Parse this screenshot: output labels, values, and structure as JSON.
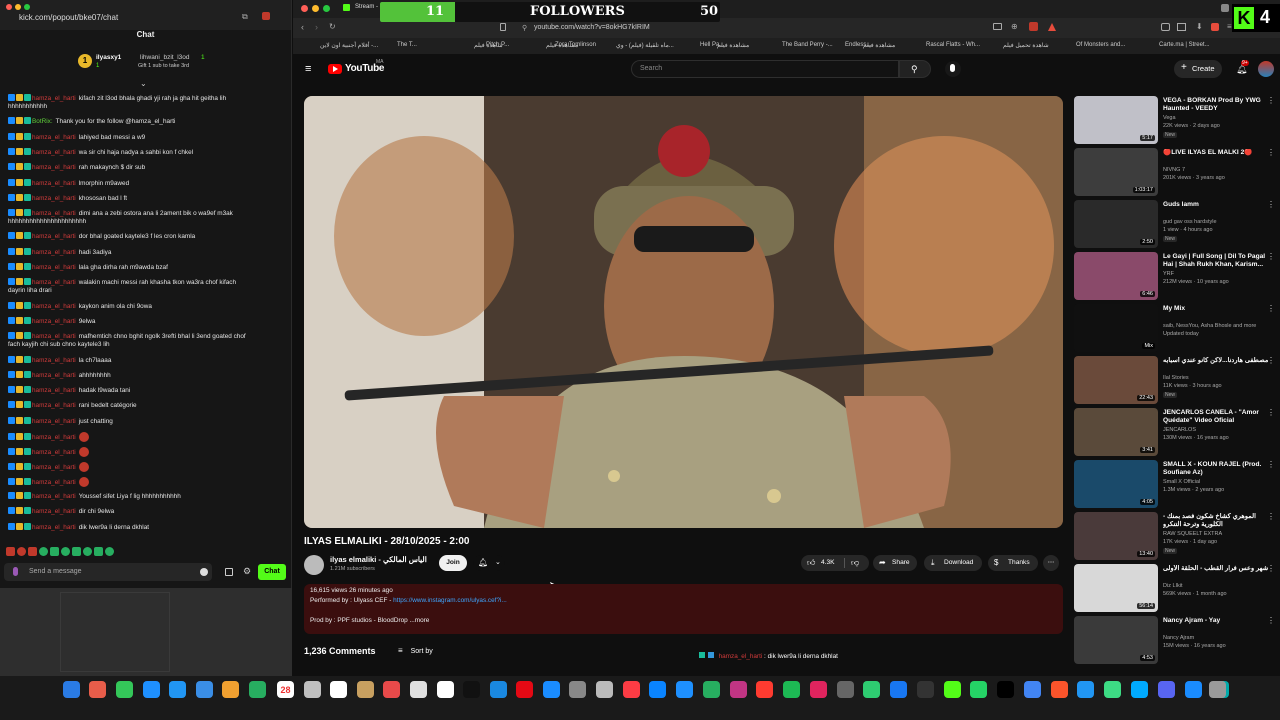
{
  "overlay": {
    "count_left": "11",
    "label": "FOLLOWERS",
    "count_right": "50",
    "progress_fraction": 0.22,
    "corner_badge": "4"
  },
  "chat": {
    "url": "kick.com/popout/bke07/chat",
    "title": "Chat",
    "pinned_user": "ilyasxy1",
    "pinned_target": "lihwani_bzit_l3od",
    "pinned_count": "1",
    "pinned_line": "Gift 1 sub to take 3rd",
    "pinned_line2": "1",
    "messages": [
      {
        "user": "hamza_el_harti",
        "text": "kifach zit l3od bhala ghadi yji rah ja gha hit geitha lih",
        "cont": "hhhhhhhhhhh"
      },
      {
        "user": "BotRix:",
        "text": "Thank you for the follow @hamza_el_harti",
        "bot": true
      },
      {
        "user": "hamza_el_harti",
        "text": "lahiyed bad messi a w9"
      },
      {
        "user": "hamza_el_harti",
        "text": "wa sir chi haja nadya a sahbi kon f chkel"
      },
      {
        "user": "hamza_el_harti",
        "text": "rah makaynch $ dir sub"
      },
      {
        "user": "hamza_el_harti",
        "text": "lmorphin m9awed"
      },
      {
        "user": "hamza_el_harti",
        "text": "khososan bad l ft"
      },
      {
        "user": "hamza_el_harti",
        "text": "dimi ana a zebi ostora ana li 2ament bik o wa9ef m3ak",
        "cont": "hhhhhhhhhhhhhhhhhhhhhh"
      },
      {
        "user": "hamza_el_harti",
        "text": "dor bhal goated kaytele3 f les cron kamla"
      },
      {
        "user": "hamza_el_harti",
        "text": "hadi 3adiya"
      },
      {
        "user": "hamza_el_harti",
        "text": "lala gha dirha rah m9awda bzaf"
      },
      {
        "user": "hamza_el_harti",
        "text": "walakin machi messi rah khasha tkon wa3ra chof kifach",
        "cont": "dayrin liha drari"
      },
      {
        "user": "hamza_el_harti",
        "text": "kaykon anim ola chi 9owa"
      },
      {
        "user": "hamza_el_harti",
        "text": "9elwa"
      },
      {
        "user": "hamza_el_harti",
        "text": "mafhemtich chno bghit ngolk 3refti bhal li 3end goated chof",
        "cont": "fach kayjih chi sub chno kaytele3 lih"
      },
      {
        "user": "hamza_el_harti",
        "text": "la ch7laaaa"
      },
      {
        "user": "hamza_el_harti",
        "text": "ahhhhhhhh"
      },
      {
        "user": "hamza_el_harti",
        "text": "hadak l9wada tani"
      },
      {
        "user": "hamza_el_harti",
        "text": "rani bedelt catégorie"
      },
      {
        "user": "hamza_el_harti",
        "text": "just chatting"
      },
      {
        "user": "hamza_el_harti",
        "text": "",
        "emote": true
      },
      {
        "user": "hamza_el_harti",
        "text": "",
        "emote": true
      },
      {
        "user": "hamza_el_harti",
        "text": "",
        "emote": true
      },
      {
        "user": "hamza_el_harti",
        "text": "",
        "emote": true
      },
      {
        "user": "hamza_el_harti",
        "text": "Youssef sifet Liya f lig hhhhhhhhhhh"
      },
      {
        "user": "hamza_el_harti",
        "text": "dir chi 9elwa"
      },
      {
        "user": "hamza_el_harti",
        "text": "dik lwer9a li derna dkhlat"
      }
    ],
    "send_placeholder": "Send a message",
    "send_button": "Chat"
  },
  "browser": {
    "tab_title": "Stream - Kick Dash",
    "url": "youtube.com/watch?v=8okHG7kIRIM",
    "bookmarks": [
      "أفلام أجنبية اون لاين -...",
      "The T...",
      "شاهدة فيلم",
      "Pitch P...",
      "مشاهدة فيلم",
      "Zora Tomlinson",
      "ماه تلقيلة (فيلم) - وي...",
      "Hell Pa...",
      "مشاهدة فيلم",
      "The Band Perry -...",
      "Endless...",
      "مشاهدة فيلم",
      "Rascal Flatts - Wh...",
      "شاهدة تحميل فيلم",
      "Of Monsters and...",
      "Carte.ma | Street..."
    ]
  },
  "youtube": {
    "logo": "YouTube",
    "logo_region": "MA",
    "search_placeholder": "Search",
    "create_label": "Create",
    "notif_count": "9+",
    "video_title": "ILYAS ELMALIKI - 28/10/2025 - 2:00",
    "channel_name": "ilyas elmaliki - الياس المالكي",
    "channel_subs": "1.21M subscribers",
    "join_label": "Join",
    "likes": "4.3K",
    "share_label": "Share",
    "download_label": "Download",
    "thanks_label": "Thanks",
    "views_line": "16,615 views  26 minutes ago",
    "performed_by": "Performed by : Ulyass CEF - ",
    "performed_link": "https://www.instagram.com/ulyas.cef?i...",
    "prod_by": "Prod by : PPF studios - BloodDrop",
    "more_label": "...more",
    "comments_count": "1,236 Comments",
    "sort_label": "Sort by",
    "overlay_user": "hamza_el_harti",
    "overlay_text": ": dik lwer9a li derna dkhlat"
  },
  "recommendations": [
    {
      "title": "VEGA - BORKAN Prod By YWG Haunted - VEEDY",
      "channel": "Vega",
      "meta": "22K views · 2 days ago",
      "badge": "New",
      "duration": "5:17",
      "color": "#c0c0c8"
    },
    {
      "title": "🔴LIVE ILYAS EL MALKI 2🔴",
      "channel": "NIVNG 7",
      "meta": "201K views · 3 years ago",
      "badge": "",
      "duration": "1:03:17",
      "color": "#3d3d3d"
    },
    {
      "title": "Guds lamm",
      "channel": "gud gav oss hardstyle",
      "meta": "1 view · 4 hours ago",
      "badge": "New",
      "duration": "2:50",
      "color": "#2a2a2a"
    },
    {
      "title": "Le Gayi | Full Song | Dil To Pagal Hai | Shah Rukh Khan, Karism...",
      "channel": "YRF",
      "meta": "212M views · 10 years ago",
      "badge": "",
      "duration": "6:46",
      "color": "#8a4a6a"
    },
    {
      "title": "My Mix",
      "channel": "saib, NessYou, Asha Bhosle and more",
      "meta": "Updated today",
      "badge": "",
      "duration": "Mix",
      "color": "#101010"
    },
    {
      "title": "مصطفى هاردنا...لاكن كانو عندي أسبابه",
      "channel": "Ilal Stories",
      "meta": "11K views · 3 hours ago",
      "badge": "New",
      "duration": "22:43",
      "color": "#6a4a3a"
    },
    {
      "title": "JENCARLOS CANELA - \"Amor Quédate\" Video Oficial",
      "channel": "JENCARLOS",
      "meta": "130M views · 16 years ago",
      "badge": "",
      "duration": "3:41",
      "color": "#5a4a3a"
    },
    {
      "title": "SMALL X - KOUN RAJEL (Prod. Soufiane Az)",
      "channel": "Small X Official",
      "meta": "1.3M views · 2 years ago",
      "badge": "",
      "duration": "4:05",
      "color": "#1a4a6a"
    },
    {
      "title": "الموهري كشاخ شكون فصد بمنك - الكلورية وترحة التنكرو",
      "channel": "RAW SQUEELT EXTRA",
      "meta": "17K views · 1 day ago",
      "badge": "New",
      "duration": "13:40",
      "color": "#4a3a3a"
    },
    {
      "title": "شهر وعس فرار القطب - الحلقة الأولى",
      "channel": "Diz LIkit",
      "meta": "569K views · 1 month ago",
      "badge": "",
      "duration": "56:14",
      "color": "#d8d8d8"
    },
    {
      "title": "Nancy Ajram - Yay",
      "channel": "Nancy Ajram",
      "meta": "15M views · 16 years ago",
      "badge": "",
      "duration": "4:53",
      "color": "#3a3a3a"
    }
  ],
  "dock": {
    "calendar_day": "28"
  }
}
